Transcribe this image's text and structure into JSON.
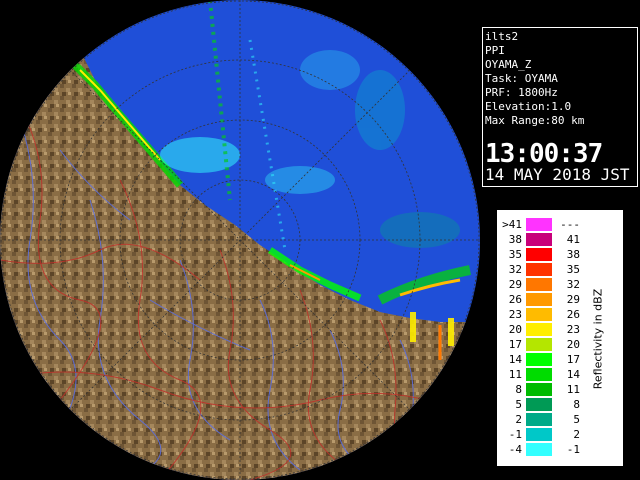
{
  "info": {
    "product": "ilts2",
    "type": "PPI",
    "site": "OYAMA_Z",
    "task": "Task: OYAMA",
    "prf": "PRF: 1800Hz",
    "elevation": "Elevation:1.0",
    "max_range": "Max Range:80 km",
    "time": "13:00:37",
    "date": "14 MAY 2018 JST"
  },
  "legend": {
    "title": "Reflectivity in dBZ",
    "rows": [
      {
        "lo": ">41",
        "hi": "---",
        "color": "#ff33ff"
      },
      {
        "lo": "38",
        "hi": "41",
        "color": "#c8007a"
      },
      {
        "lo": "35",
        "hi": "38",
        "color": "#ff0000"
      },
      {
        "lo": "32",
        "hi": "35",
        "color": "#ff3300"
      },
      {
        "lo": "29",
        "hi": "32",
        "color": "#ff7700"
      },
      {
        "lo": "26",
        "hi": "29",
        "color": "#ff9900"
      },
      {
        "lo": "23",
        "hi": "26",
        "color": "#ffbb00"
      },
      {
        "lo": "20",
        "hi": "23",
        "color": "#ffee00"
      },
      {
        "lo": "17",
        "hi": "20",
        "color": "#b4e600"
      },
      {
        "lo": "14",
        "hi": "17",
        "color": "#00ff00"
      },
      {
        "lo": "11",
        "hi": "14",
        "color": "#00dc00"
      },
      {
        "lo": "8",
        "hi": "11",
        "color": "#00bb00"
      },
      {
        "lo": "5",
        "hi": "8",
        "color": "#009a55"
      },
      {
        "lo": "2",
        "hi": "5",
        "color": "#00aa88"
      },
      {
        "lo": "-1",
        "hi": "2",
        "color": "#00c8c8"
      },
      {
        "lo": "-4",
        "hi": "-1",
        "color": "#33ffff"
      }
    ]
  },
  "colors": {
    "sea": "#1f4fd8",
    "land": "#8a6d45",
    "outside": "#000000",
    "rivers": "#5a6ee0",
    "boundaries": "#c0302a"
  }
}
